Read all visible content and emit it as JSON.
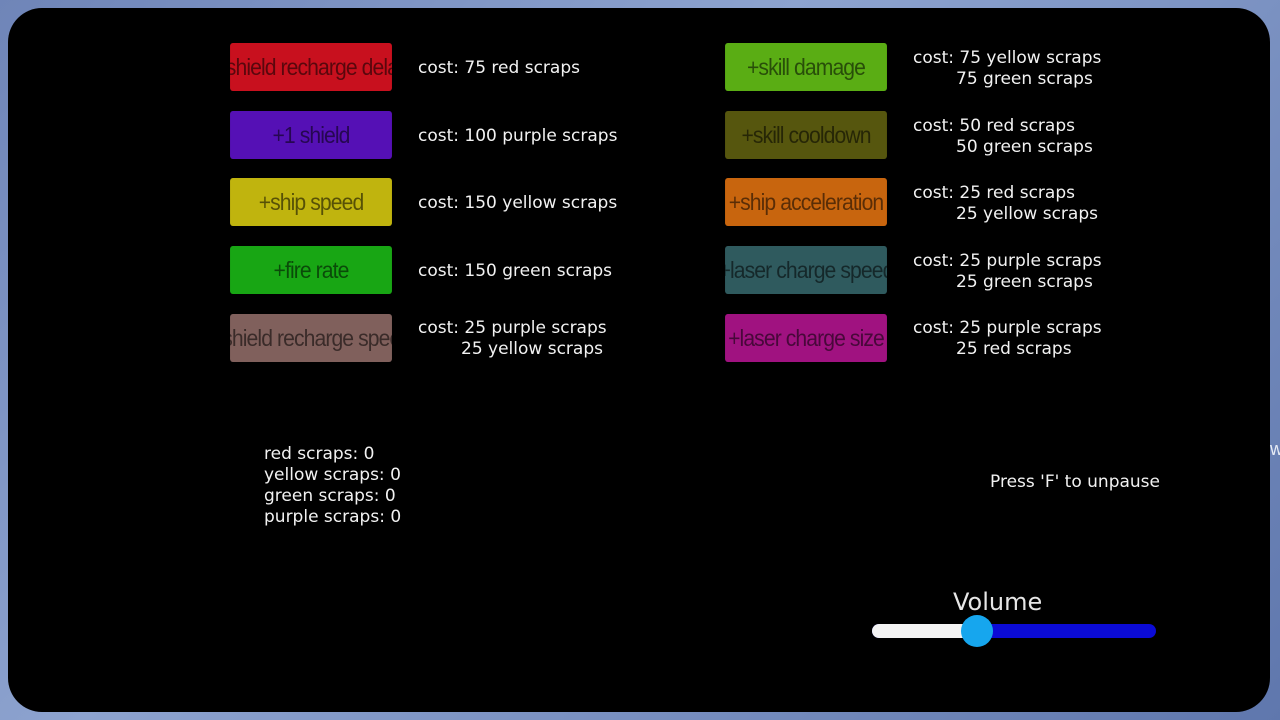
{
  "edge_text": "w e ig il a e g",
  "upgrades_left": [
    {
      "label": "+shield recharge delay",
      "color": "#c8101e",
      "cost_line1": "cost: 75 red scraps",
      "cost_line2": ""
    },
    {
      "label": "+1 shield",
      "color": "#5510b5",
      "cost_line1": "cost: 100 purple scraps",
      "cost_line2": ""
    },
    {
      "label": "+ship speed",
      "color": "#c0b40e",
      "cost_line1": "cost: 150 yellow scraps",
      "cost_line2": ""
    },
    {
      "label": "+fire rate",
      "color": "#18a614",
      "cost_line1": "cost: 150 green scraps",
      "cost_line2": ""
    },
    {
      "label": "+shield recharge speed",
      "color": "#80605c",
      "cost_line1": "cost: 25 purple scraps",
      "cost_line2": "25 yellow scraps"
    }
  ],
  "upgrades_right": [
    {
      "label": "+skill damage",
      "color": "#5aad14",
      "cost_line1": "cost: 75 yellow scraps",
      "cost_line2": "75 green scraps"
    },
    {
      "label": "+skill cooldown",
      "color": "#56560e",
      "cost_line1": "cost: 50 red scraps",
      "cost_line2": "50 green scraps"
    },
    {
      "label": "+ship acceleration",
      "color": "#c8650e",
      "cost_line1": "cost: 25 red scraps",
      "cost_line2": "25 yellow scraps"
    },
    {
      "label": "+laser charge speed",
      "color": "#2f5a5e",
      "cost_line1": "cost: 25 purple scraps",
      "cost_line2": "25 green scraps"
    },
    {
      "label": "+laser charge size",
      "color": "#a01280",
      "cost_line1": "cost: 25 purple scraps",
      "cost_line2": "25 red scraps"
    }
  ],
  "scraps": {
    "red": "red scraps: 0",
    "yellow": "yellow scraps: 0",
    "green": "green scraps: 0",
    "purple": "purple scraps: 0"
  },
  "unpause_hint": "Press 'F' to unpause",
  "volume": {
    "label": "Volume",
    "level": 0.37,
    "track_color": "#0b0bd6",
    "fill_color": "#f4f4f4",
    "knob_color": "#16a6ee"
  }
}
